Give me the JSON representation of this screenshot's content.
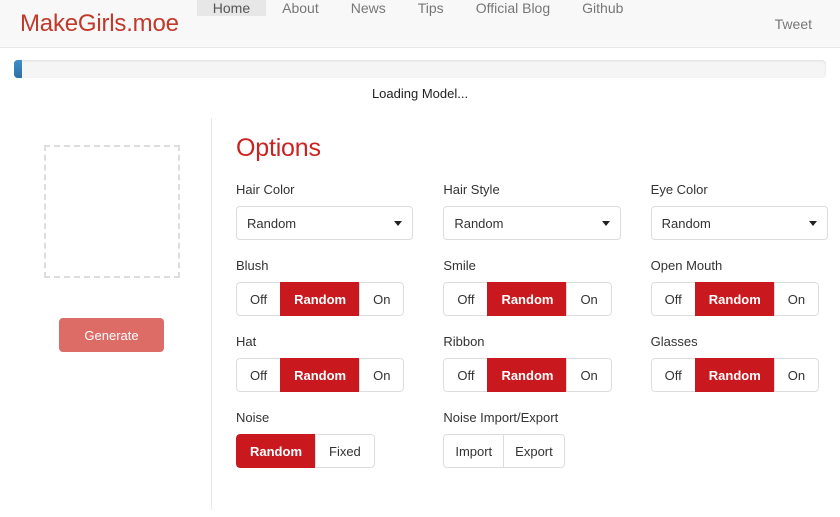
{
  "navbar": {
    "brand": "MakeGirls.moe",
    "items": [
      {
        "label": "Home",
        "active": true
      },
      {
        "label": "About",
        "active": false
      },
      {
        "label": "News",
        "active": false
      },
      {
        "label": "Tips",
        "active": false
      },
      {
        "label": "Official Blog",
        "active": false
      },
      {
        "label": "Github",
        "active": false
      }
    ],
    "tweet": "Tweet"
  },
  "progress": {
    "percent": 1,
    "percent_label": "1%",
    "status": "Loading Model...",
    "bar_color": "#337ab7"
  },
  "left_panel": {
    "placeholder_alt": "image-placeholder",
    "generate_label": "Generate",
    "generate_color": "#dd6b66"
  },
  "options": {
    "title": "Options",
    "title_color": "#cc2222",
    "active_color": "#c9191e",
    "selects": {
      "hair_color": {
        "label": "Hair Color",
        "value": "Random"
      },
      "hair_style": {
        "label": "Hair Style",
        "value": "Random"
      },
      "eye_color": {
        "label": "Eye Color",
        "value": "Random"
      }
    },
    "toggles": {
      "blush": {
        "label": "Blush",
        "options": [
          "Off",
          "Random",
          "On"
        ],
        "selected": "Random"
      },
      "smile": {
        "label": "Smile",
        "options": [
          "Off",
          "Random",
          "On"
        ],
        "selected": "Random"
      },
      "open_mouth": {
        "label": "Open Mouth",
        "options": [
          "Off",
          "Random",
          "On"
        ],
        "selected": "Random"
      },
      "hat": {
        "label": "Hat",
        "options": [
          "Off",
          "Random",
          "On"
        ],
        "selected": "Random"
      },
      "ribbon": {
        "label": "Ribbon",
        "options": [
          "Off",
          "Random",
          "On"
        ],
        "selected": "Random"
      },
      "glasses": {
        "label": "Glasses",
        "options": [
          "Off",
          "Random",
          "On"
        ],
        "selected": "Random"
      },
      "noise": {
        "label": "Noise",
        "options": [
          "Random",
          "Fixed"
        ],
        "selected": "Random"
      }
    },
    "noise_io": {
      "label": "Noise Import/Export",
      "import_label": "Import",
      "export_label": "Export"
    }
  }
}
